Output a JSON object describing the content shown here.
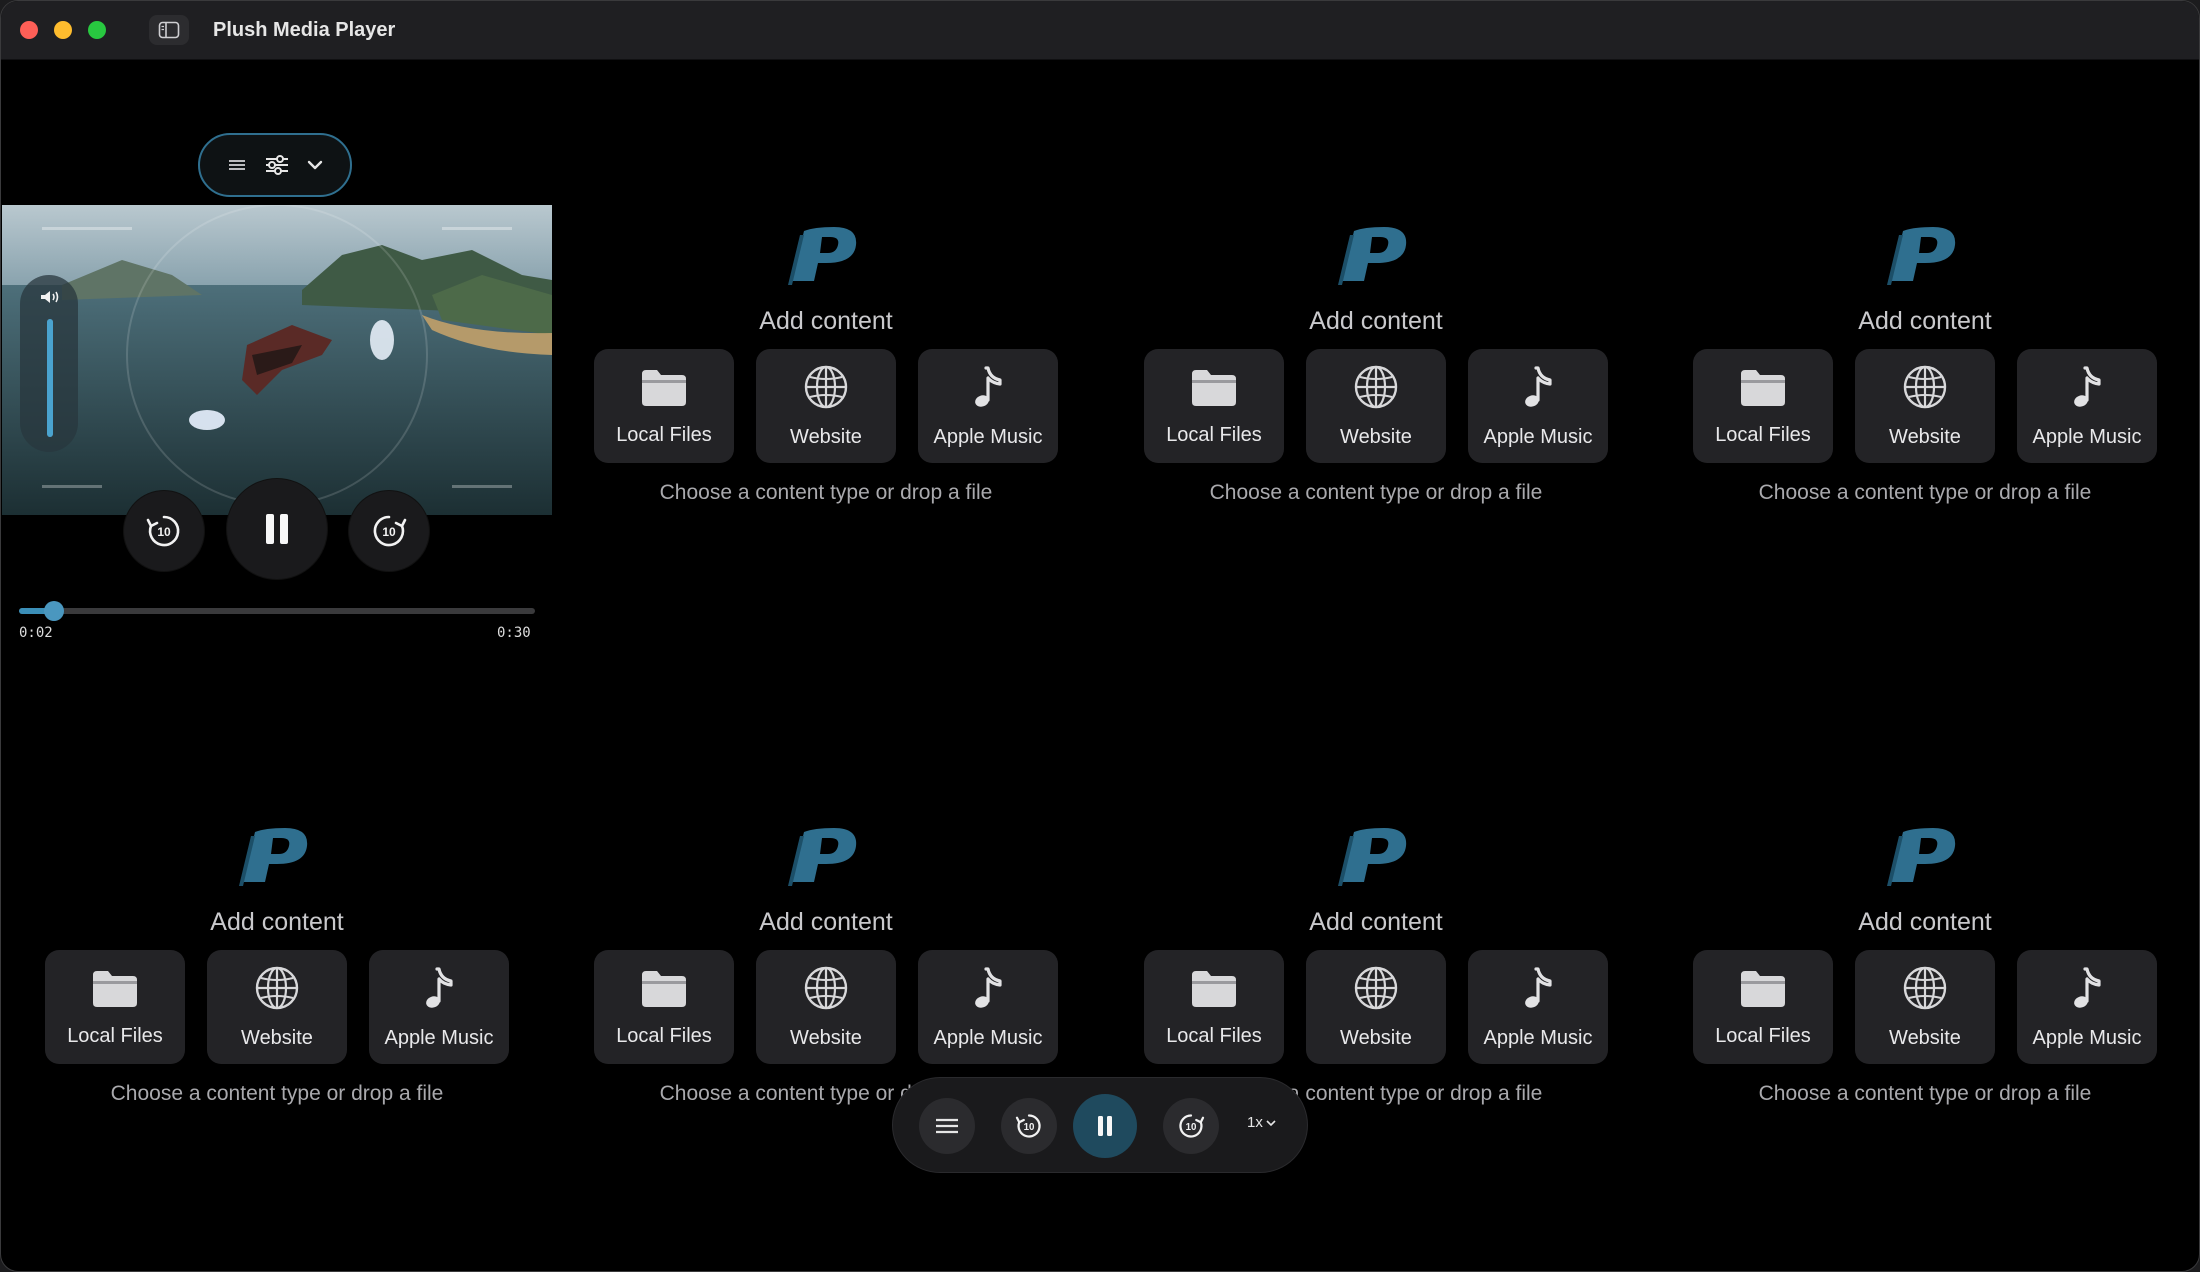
{
  "app": {
    "title": "Plush Media Player"
  },
  "player": {
    "current_time": "0:02",
    "duration": "0:30",
    "progress": 0.067,
    "volume": 1.0,
    "skip_back_label": "10",
    "skip_forward_label": "10"
  },
  "slots": [
    {
      "title": "Add content",
      "hint": "Choose a content type or drop a file",
      "options": [
        "Local Files",
        "Website",
        "Apple Music"
      ]
    },
    {
      "title": "Add content",
      "hint": "Choose a content type or drop a file",
      "options": [
        "Local Files",
        "Website",
        "Apple Music"
      ]
    },
    {
      "title": "Add content",
      "hint": "Choose a content type or drop a file",
      "options": [
        "Local Files",
        "Website",
        "Apple Music"
      ]
    },
    {
      "title": "Add content",
      "hint": "Choose a content type or drop a file",
      "options": [
        "Local Files",
        "Website",
        "Apple Music"
      ]
    },
    {
      "title": "Add content",
      "hint": "Choose a content type or drop a file",
      "options": [
        "Local Files",
        "Website",
        "Apple Music"
      ]
    },
    {
      "title": "Add content",
      "hint": "Choose a content type or drop a file",
      "options": [
        "Local Files",
        "Website",
        "Apple Music"
      ]
    },
    {
      "title": "Add content",
      "hint": "Choose a content type or drop a file",
      "options": [
        "Local Files",
        "Website",
        "Apple Music"
      ]
    }
  ],
  "bottom_bar": {
    "speed": "1x"
  },
  "colors": {
    "accent": "#3b8fb8",
    "logo": "#2f6f8f"
  }
}
